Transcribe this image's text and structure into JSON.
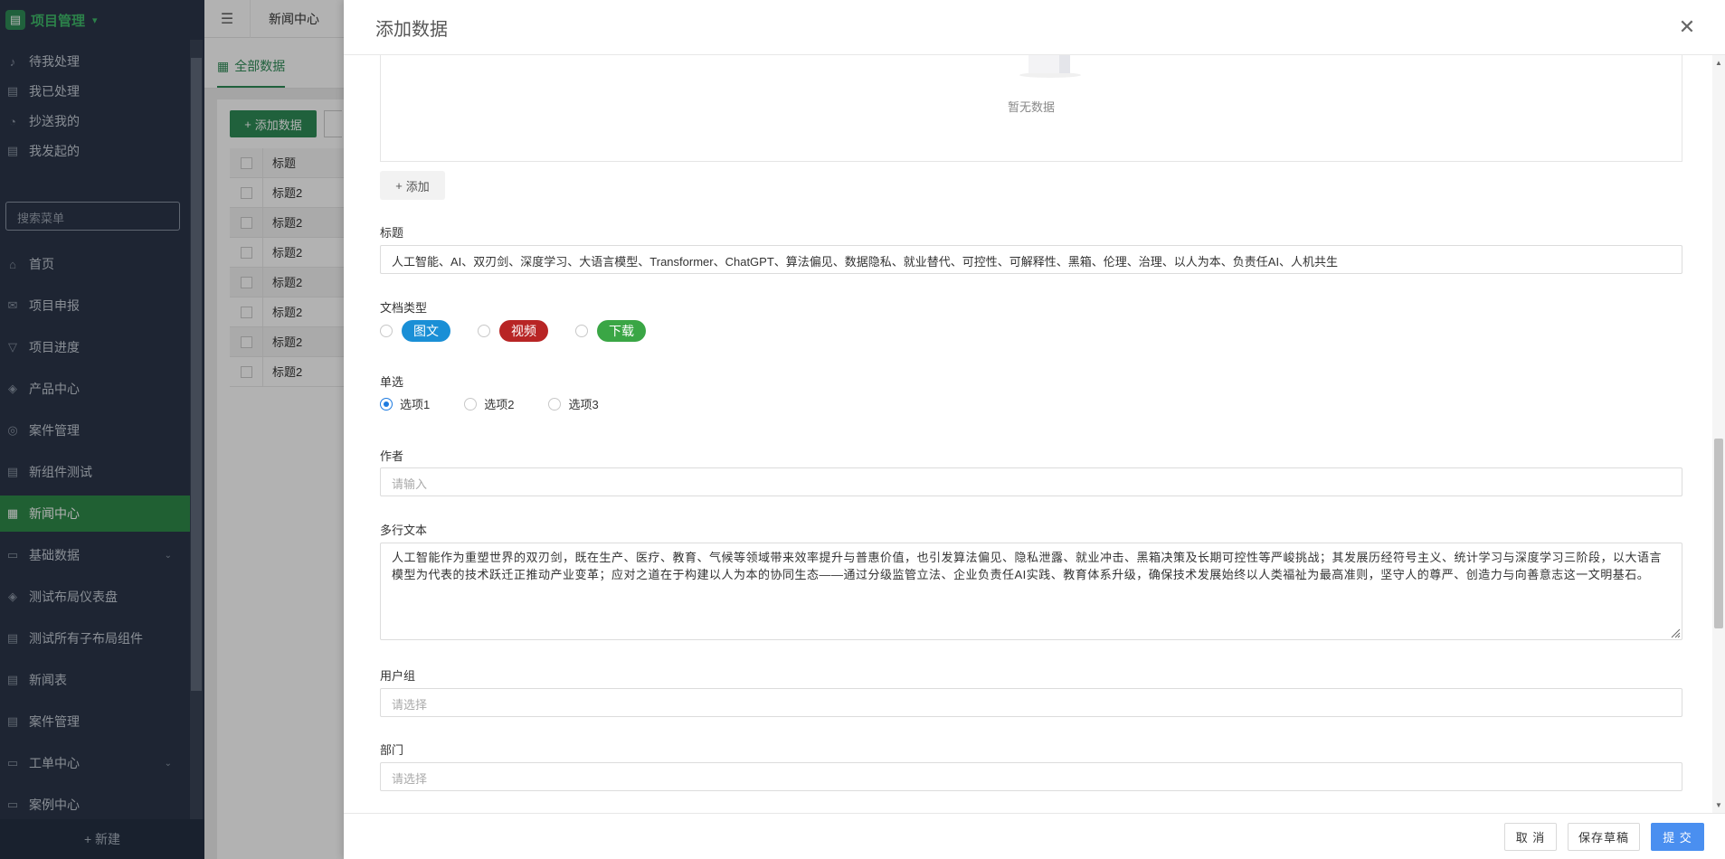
{
  "sidebar": {
    "app_title": "项目管理",
    "search_placeholder": "搜索菜单",
    "new_label": "+ 新建",
    "top_items": [
      {
        "label": "待我处理",
        "icon": "bell-icon"
      },
      {
        "label": "我已处理",
        "icon": "doc-icon"
      },
      {
        "label": "抄送我的",
        "icon": "user-icon"
      },
      {
        "label": "我发起的",
        "icon": "doc-icon"
      }
    ],
    "items": [
      {
        "label": "首页",
        "icon": "home-icon"
      },
      {
        "label": "项目申报",
        "icon": "mail-icon"
      },
      {
        "label": "项目进度",
        "icon": "filter-icon"
      },
      {
        "label": "产品中心",
        "icon": "layers-icon"
      },
      {
        "label": "案件管理",
        "icon": "circle-icon"
      },
      {
        "label": "新组件测试",
        "icon": "doc-icon"
      },
      {
        "label": "新闻中心",
        "icon": "news-icon",
        "active": true
      },
      {
        "label": "基础数据",
        "icon": "folder-icon",
        "expandable": true
      },
      {
        "label": "测试布局仪表盘",
        "icon": "layers-icon"
      },
      {
        "label": "测试所有子布局组件",
        "icon": "doc-icon"
      },
      {
        "label": "新闻表",
        "icon": "doc-icon"
      },
      {
        "label": "案件管理",
        "icon": "doc-icon"
      },
      {
        "label": "工单中心",
        "icon": "folder-icon",
        "expandable": true
      },
      {
        "label": "案例中心",
        "icon": "folder-icon"
      }
    ]
  },
  "topbar": {
    "tab_label": "新闻中心"
  },
  "subtab": {
    "label": "全部数据"
  },
  "list": {
    "add_button": "添加数据",
    "column_title": "标题",
    "rows": [
      "标题2",
      "标题2",
      "标题2",
      "标题2",
      "标题2",
      "标题2",
      "标题2"
    ]
  },
  "drawer": {
    "title": "添加数据",
    "empty_text": "暂无数据",
    "add_row_label": "添加",
    "fields": {
      "title_label": "标题",
      "title_value": "人工智能、AI、双刃剑、深度学习、大语言模型、Transformer、ChatGPT、算法偏见、数据隐私、就业替代、可控性、可解释性、黑箱、伦理、治理、以人为本、负责任AI、人机共生",
      "doctype_label": "文档类型",
      "doctype_options": [
        {
          "label": "图文",
          "color": "#1a8fd6"
        },
        {
          "label": "视频",
          "color": "#b82525"
        },
        {
          "label": "下载",
          "color": "#3aa645"
        }
      ],
      "single_label": "单选",
      "single_options": [
        "选项1",
        "选项2",
        "选项3"
      ],
      "single_selected": "选项1",
      "author_label": "作者",
      "author_placeholder": "请输入",
      "multiline_label": "多行文本",
      "multiline_value": "人工智能作为重塑世界的双刃剑，既在生产、医疗、教育、气候等领域带来效率提升与普惠价值，也引发算法偏见、隐私泄露、就业冲击、黑箱决策及长期可控性等严峻挑战；其发展历经符号主义、统计学习与深度学习三阶段，以大语言模型为代表的技术跃迁正推动产业变革；应对之道在于构建以人为本的协同生态——通过分级监管立法、企业负责任AI实践、教育体系升级，确保技术发展始终以人类福祉为最高准则，坚守人的尊严、创造力与向善意志这一文明基石。",
      "usergroup_label": "用户组",
      "usergroup_placeholder": "请选择",
      "dept_label": "部门",
      "dept_placeholder": "请选择"
    },
    "footer": {
      "cancel": "取 消",
      "draft": "保存草稿",
      "submit": "提 交"
    }
  }
}
